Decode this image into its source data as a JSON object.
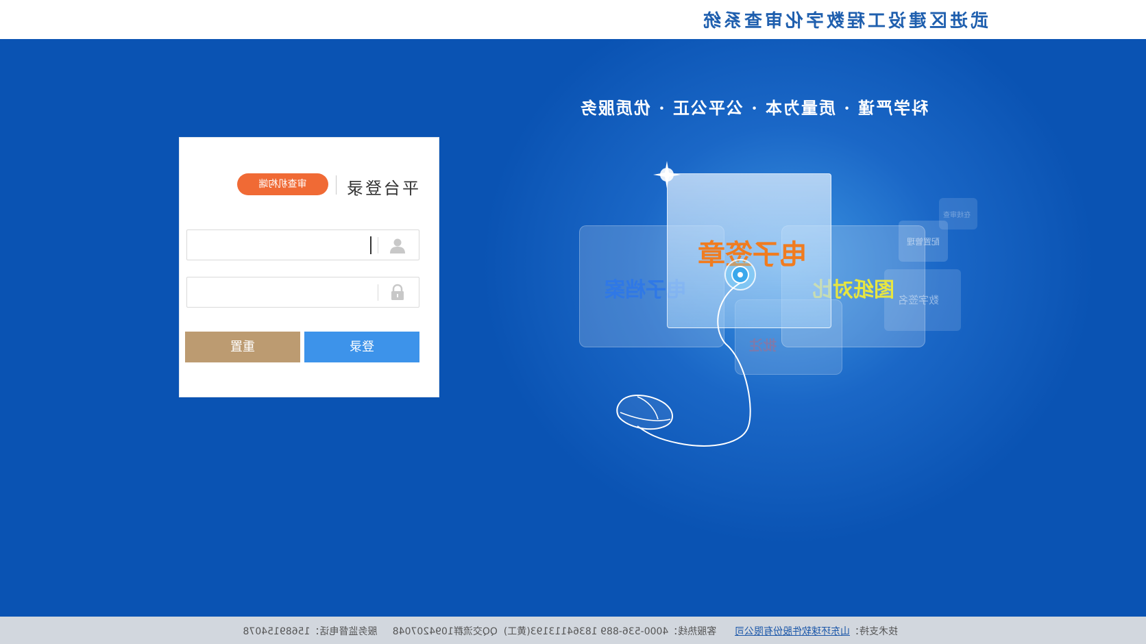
{
  "header": {
    "title": "武进区建设工程数字化审查系统"
  },
  "slogan": "科学严谨 · 质量为本 · 公平公正 · 优质服务",
  "login": {
    "title": "平台登录",
    "role_tag": "审查机构端",
    "username": {
      "value": "",
      "placeholder": ""
    },
    "password": {
      "value": "",
      "placeholder": ""
    },
    "reset_label": "重置",
    "login_label": "登录"
  },
  "illustration": {
    "cards": {
      "seal": "电子签章",
      "archive": "电子档案",
      "compare": "图纸对比",
      "sign": "数字签名",
      "config": "配置管理",
      "annotate": "批注",
      "small_tag": "在线审查"
    }
  },
  "footer": {
    "tech_support_label": "技术支持：",
    "tech_support_company": "山东环球软件股份有限公司",
    "hotline_label": "客服热线：",
    "hotline": "4000-536-889 18364113193(黄工)",
    "qq_label": "QQ交流群",
    "qq": "1094207048",
    "supervision_label": "服务监督电话：",
    "supervision": "15689154078"
  },
  "colors": {
    "brand_blue": "#0a53b3",
    "header_title": "#1f5fae",
    "login_button": "#3d93ea",
    "reset_button": "#bc9b71",
    "role_tag": "#f06a35",
    "seal_text": "#f07c20",
    "archive_text": "#2f78e6",
    "compare_text": "#e8e640"
  },
  "icons": [
    "user-icon",
    "lock-icon",
    "mouse-icon",
    "sparkle-icon"
  ]
}
